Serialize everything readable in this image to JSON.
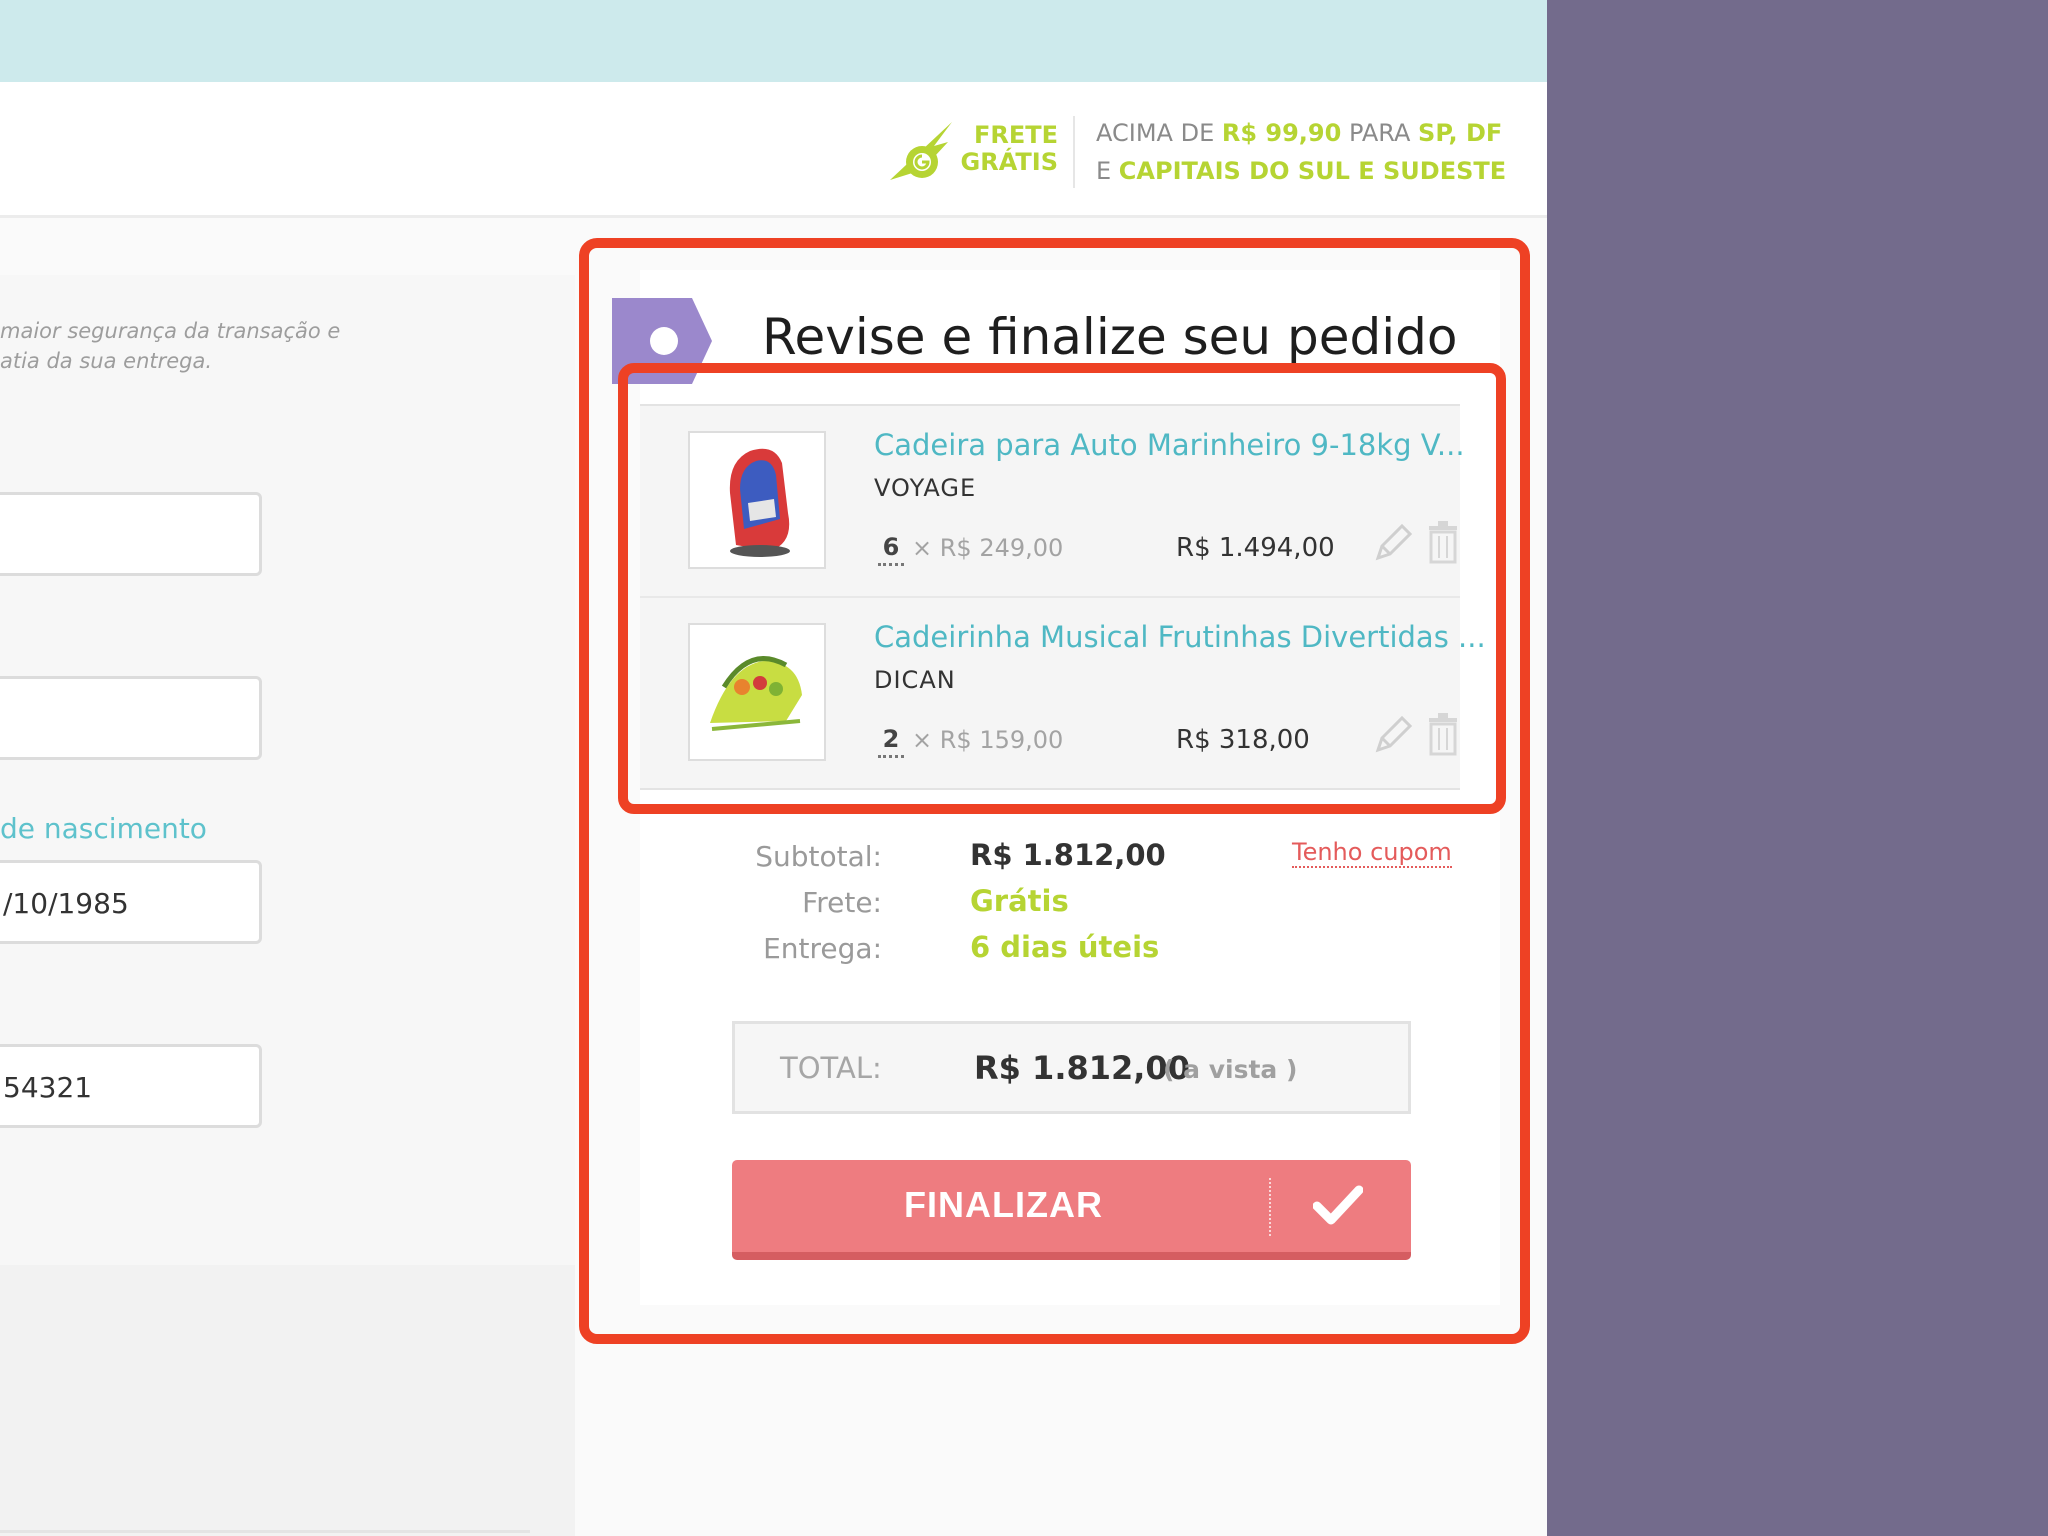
{
  "header": {
    "frete_line1": "FRETE",
    "frete_line2": "GRÁTIS",
    "info_prefix": "ACIMA DE ",
    "info_amount": "R$ 99,90",
    "info_para": " PARA ",
    "info_states": "SP, DF",
    "info_e": "E ",
    "info_regions": "CAPITAIS DO SUL E SUDESTE"
  },
  "form": {
    "hint_line1": "maior segurança da transação e",
    "hint_line2": "atia da sua entrega.",
    "field1_value": "",
    "field2_value": "",
    "birth_label": "de nascimento",
    "birth_value": "/10/1985",
    "phone_value": "54321"
  },
  "summary": {
    "title": "Revise e finalize seu pedido",
    "items": [
      {
        "name": "Cadeira para Auto Marinheiro 9-18kg V...",
        "brand": "VOYAGE",
        "quantity": "6",
        "unit_price": "× R$ 249,00",
        "line_total": "R$ 1.494,00"
      },
      {
        "name": "Cadeirinha Musical Frutinhas Divertidas ...",
        "brand": "DICAN",
        "quantity": "2",
        "unit_price": "× R$ 159,00",
        "line_total": "R$ 318,00"
      }
    ],
    "subtotal_label": "Subtotal:",
    "subtotal_value": "R$ 1.812,00",
    "frete_label": "Frete:",
    "frete_value": "Grátis",
    "entrega_label": "Entrega:",
    "entrega_value": "6 dias úteis",
    "coupon_link": "Tenho cupom",
    "total_label": "TOTAL:",
    "total_value": "R$ 1.812,00",
    "total_note": "( a vista )",
    "finalize_label": "FINALIZAR"
  },
  "colors": {
    "accent_green": "#b6d433",
    "link_teal": "#4fb8c4",
    "finalize_red": "#ee7c80",
    "annotation_red": "#ee4124",
    "side_purple": "#736b8c"
  }
}
